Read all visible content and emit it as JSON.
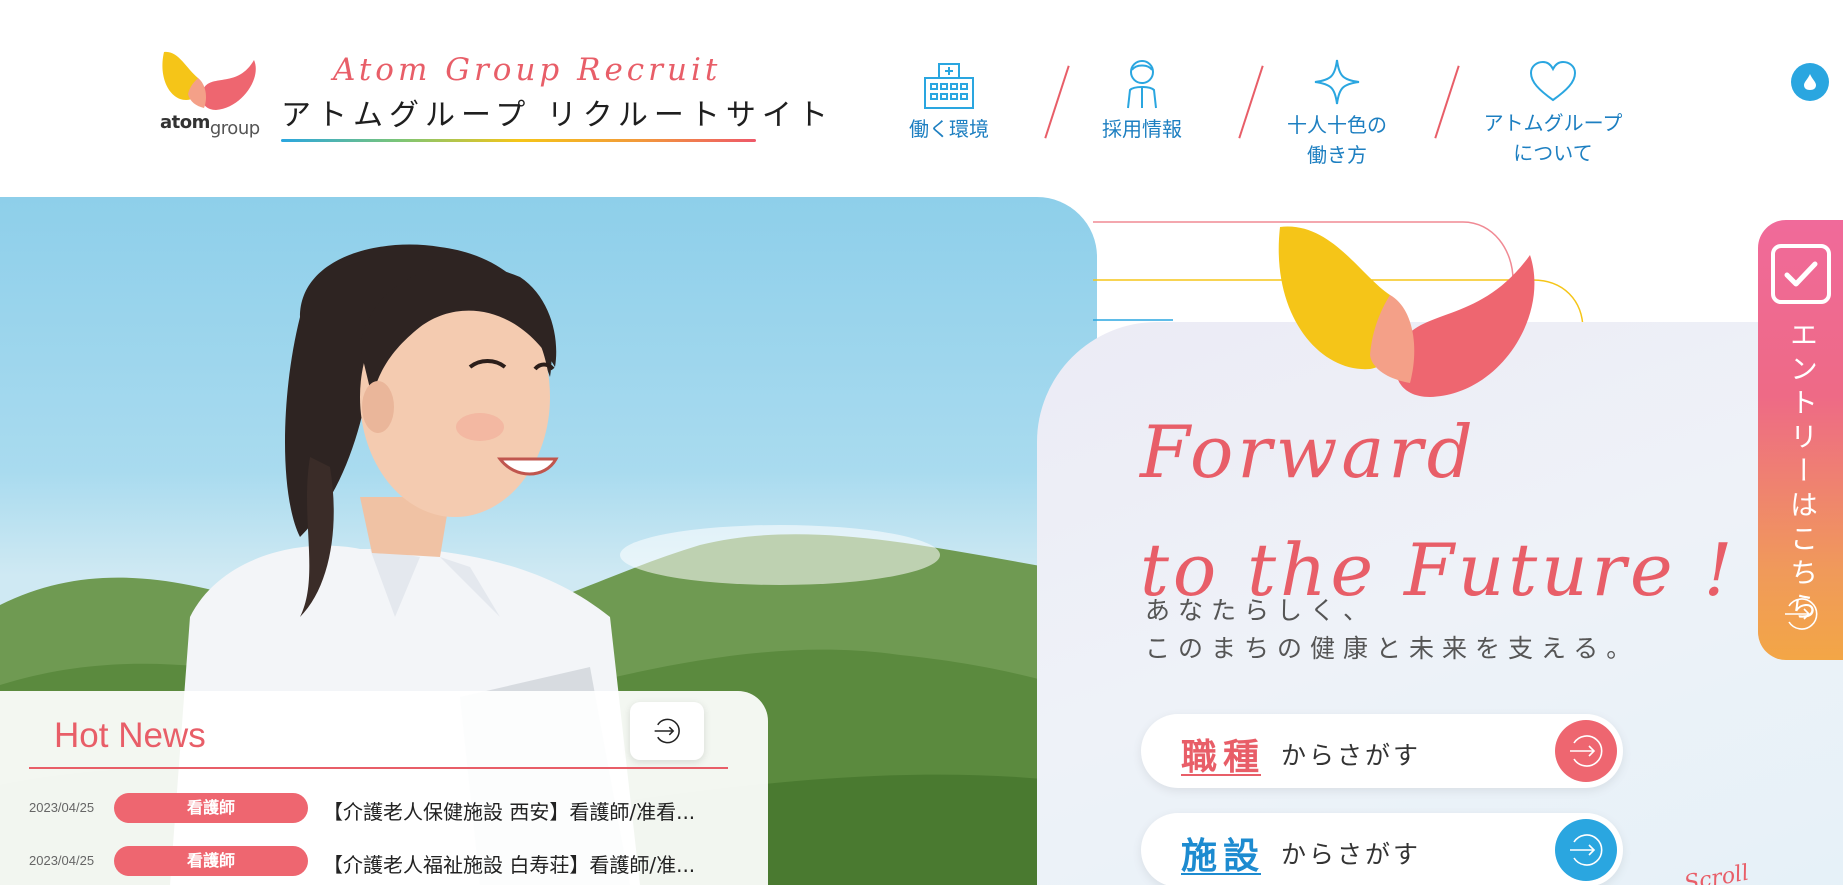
{
  "header": {
    "logo_word": "atom",
    "logo_word2": "group",
    "brand_en": "Atom Group Recruit",
    "brand_jp": "アトムグループ リクルートサイト",
    "nav": [
      {
        "label": "働く環境",
        "icon": "hospital-icon"
      },
      {
        "label": "採用情報",
        "icon": "person-icon"
      },
      {
        "label": "十人十色の\n働き方",
        "icon": "sparkle-icon"
      },
      {
        "label": "アトムグループ\nについて",
        "icon": "heart-icon"
      }
    ],
    "nav_labels": {
      "n1": "働く環境",
      "n2": "採用情報",
      "n3a": "十人十色の",
      "n3b": "働き方",
      "n4a": "アトムグループ",
      "n4b": "について"
    },
    "accessibility_icon": "drop-icon"
  },
  "hero": {
    "tagline_en_1": "Forward",
    "tagline_en_2": "to the Future !",
    "tagline_jp_1": "あなたらしく、",
    "tagline_jp_2": "このまちの健康と未来を支える。",
    "search": [
      {
        "keyword": "職種",
        "rest": "からさがす",
        "color": "#e85e68"
      },
      {
        "keyword": "施設",
        "rest": "からさがす",
        "color": "#1d8bd0"
      }
    ],
    "scroll": "Scroll"
  },
  "entry": {
    "label": "エントリーはこちら"
  },
  "news": {
    "title": "Hot News",
    "items": [
      {
        "date": "2023/04/25",
        "category": "看護師",
        "text": "【介護老人保健施設 西安】看護師/准看..."
      },
      {
        "date": "2023/04/25",
        "category": "看護師",
        "text": "【介護老人福祉施設 白寿荘】看護師/准..."
      }
    ]
  },
  "colors": {
    "accent_red": "#e85e68",
    "accent_blue": "#1d7fc1",
    "accent_yellow": "#f5c518"
  }
}
